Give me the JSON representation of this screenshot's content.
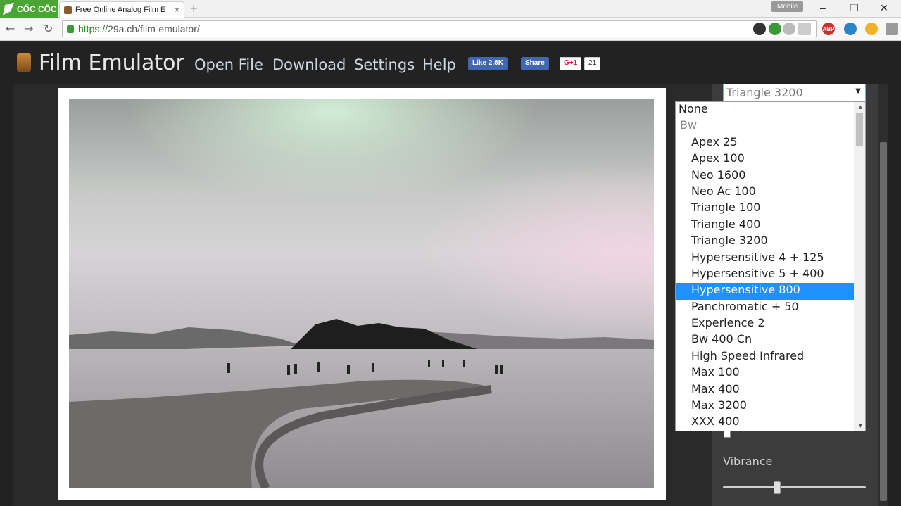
{
  "browser": {
    "brand": "CỐC CỐC",
    "tab_title": "Free Online Analog Film E",
    "tab_close": "×",
    "new_tab": "+",
    "mobile_badge": "Mobile",
    "url_protocol": "https://",
    "url_rest": "29a.ch/film-emulator/",
    "win_minimize": "–",
    "win_maximize": "❐",
    "win_close": "✕",
    "nav_back": "←",
    "nav_forward": "→",
    "nav_reload": "↻",
    "ext_abp": "ABP"
  },
  "site": {
    "title": "Film Emulator",
    "menu": [
      "Open File",
      "Download",
      "Settings",
      "Help"
    ],
    "fb_like": "Like 2.8K",
    "fb_share": "Share",
    "gplus": "G+1",
    "gplus_count": "21"
  },
  "film_select": {
    "selected": "Triangle 3200",
    "arrow": "▼",
    "options": [
      "None",
      "Bw",
      "Apex 25",
      "Apex 100",
      "Neo 1600",
      "Neo Ac 100",
      "Triangle 100",
      "Triangle 400",
      "Triangle 3200",
      "Hypersensitive 4 + 125",
      "Hypersensitive 5 + 400",
      "Hypersensitive 800",
      "Panchromatic + 50",
      "Experience 2",
      "Bw 400 Cn",
      "High Speed Infrared",
      "Max 100",
      "Max 400",
      "Max 3200",
      "XXX 400"
    ],
    "highlighted_index": 11,
    "scroll_up": "▲",
    "scroll_down": "▼"
  },
  "controls": {
    "vibrance_label": "Vibrance",
    "vibrance_value": 0.4
  }
}
